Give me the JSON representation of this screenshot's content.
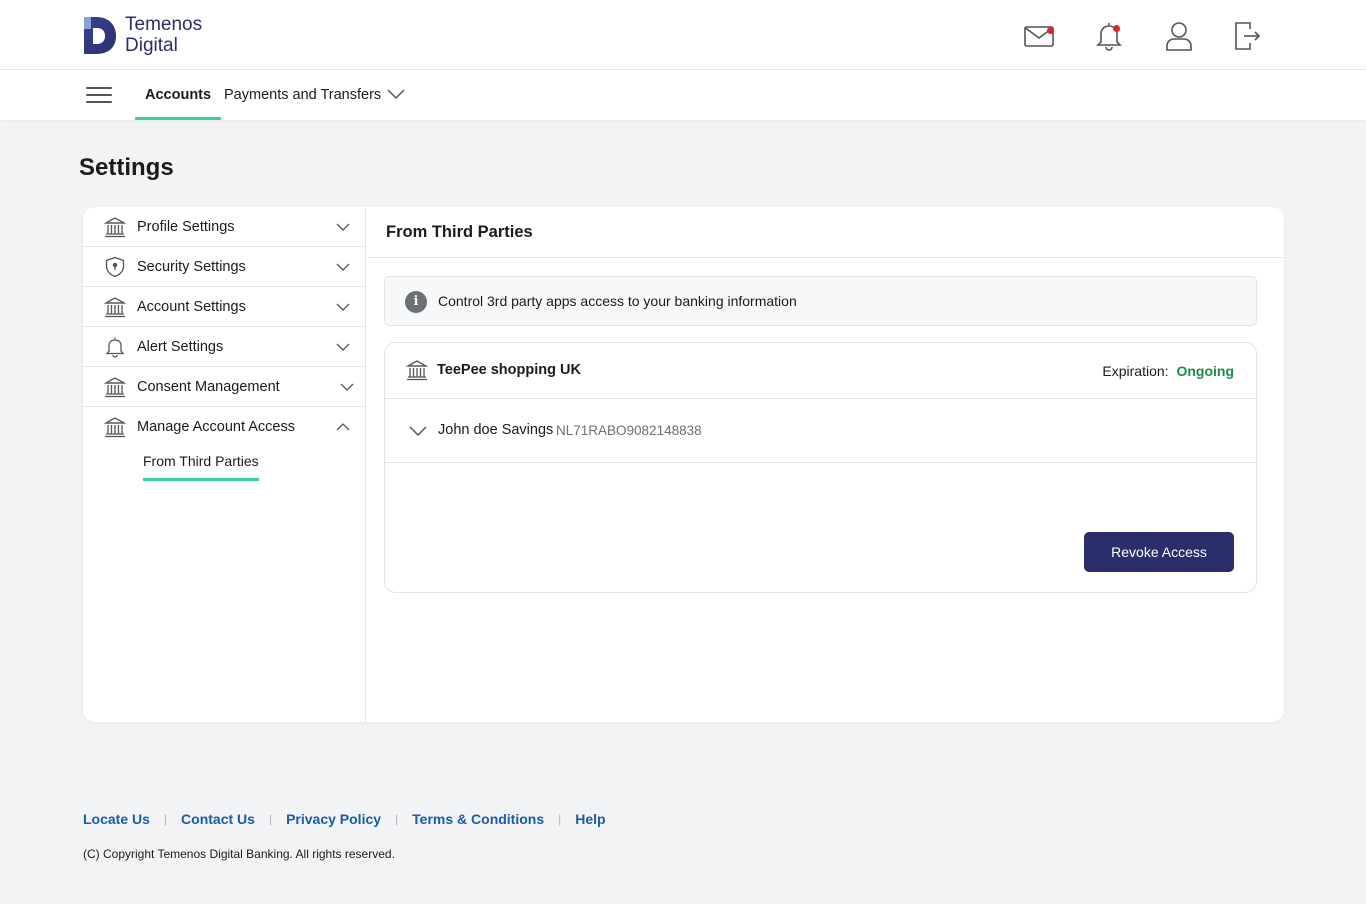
{
  "brand": {
    "name_line1": "Temenos",
    "name_line2": "Digital",
    "primary_color": "#2a2f6b",
    "accent_color": "#3ecfa0"
  },
  "header": {
    "icons": [
      "mail-icon",
      "bell-icon",
      "user-icon",
      "logout-icon"
    ],
    "notification_dot_color": "#e0262b"
  },
  "nav": {
    "tabs": [
      {
        "label": "Accounts",
        "active": true
      },
      {
        "label": "Payments and Transfers",
        "active": false
      }
    ]
  },
  "page": {
    "title": "Settings"
  },
  "sidebar": {
    "items": [
      {
        "label": "Profile Settings",
        "icon": "bank-icon",
        "expanded": false
      },
      {
        "label": "Security Settings",
        "icon": "shield-icon",
        "expanded": false
      },
      {
        "label": "Account Settings",
        "icon": "bank-icon",
        "expanded": false
      },
      {
        "label": "Alert Settings",
        "icon": "bell-icon",
        "expanded": false
      },
      {
        "label": "Consent Management",
        "icon": "bank-icon",
        "expanded": false
      },
      {
        "label": "Manage Account Access",
        "icon": "bank-icon",
        "expanded": true
      }
    ],
    "sub_item": "From Third Parties"
  },
  "main": {
    "title": "From Third Parties",
    "info_text": "Control 3rd party apps access to your banking information",
    "party": {
      "name": "TeePee shopping UK",
      "expiration_label": "Expiration:",
      "expiration_value": "Ongoing",
      "status_color": "#1e8a4a",
      "account_name": "John doe Savings",
      "account_iban": "NL71RABO9082148838",
      "revoke_label": "Revoke Access"
    }
  },
  "footer": {
    "links": [
      "Locate Us",
      "Contact Us",
      "Privacy Policy",
      "Terms & Conditions",
      "Help"
    ],
    "copyright": "(C) Copyright Temenos Digital Banking. All rights reserved."
  }
}
